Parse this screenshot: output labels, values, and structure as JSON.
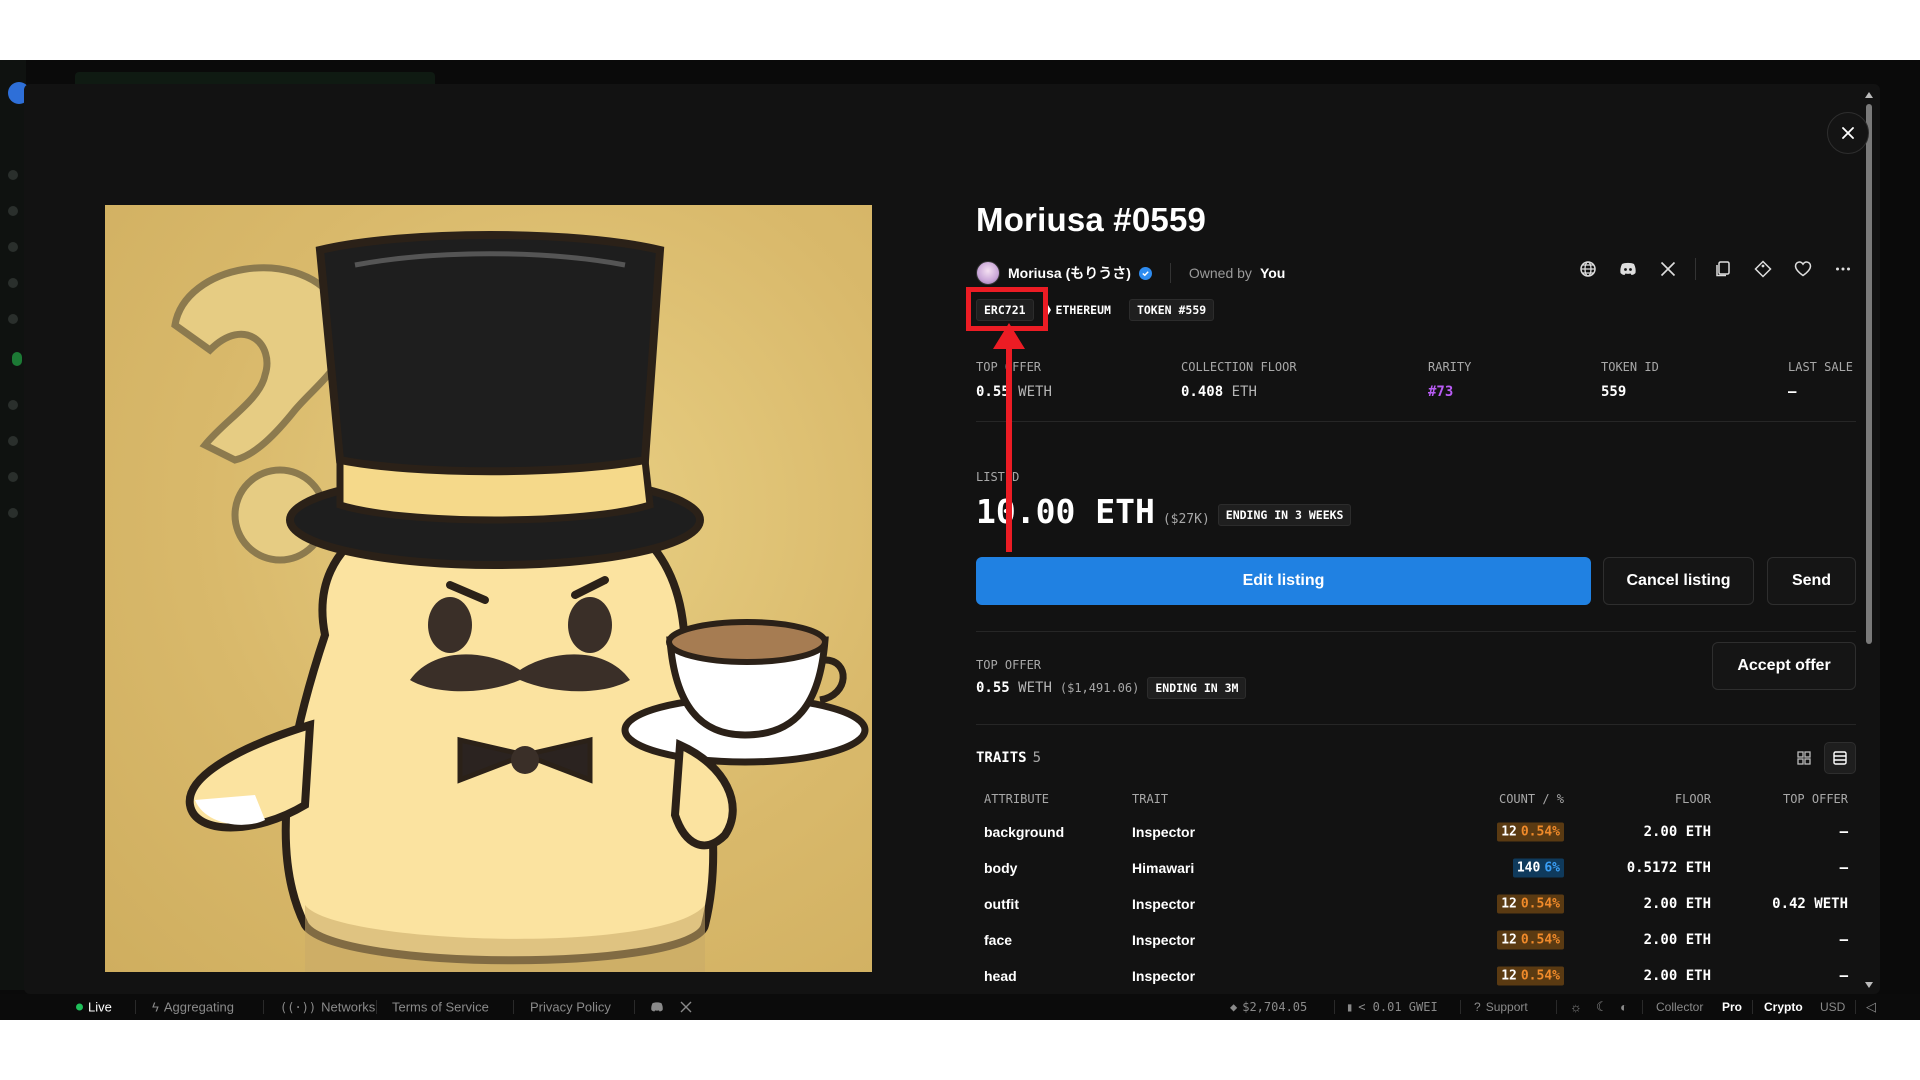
{
  "nft": {
    "title": "Moriusa #0559",
    "collection": "Moriusa (もりうさ)",
    "owned_by_label": "Owned by",
    "owner": "You"
  },
  "tags": {
    "standard": "ERC721",
    "chain": "ETHEREUM",
    "token": "TOKEN #559"
  },
  "stats": [
    {
      "label": "TOP OFFER",
      "value": "0.55",
      "unit": "WETH"
    },
    {
      "label": "COLLECTION FLOOR",
      "value": "0.408",
      "unit": "ETH"
    },
    {
      "label": "RARITY",
      "value": "#73",
      "unit": ""
    },
    {
      "label": "TOKEN ID",
      "value": "559",
      "unit": ""
    },
    {
      "label": "LAST SALE",
      "value": "–",
      "unit": ""
    }
  ],
  "listing": {
    "label": "LISTED",
    "price": "10.00 ETH",
    "usd": "($27K)",
    "ending": "ENDING IN 3 WEEKS"
  },
  "buttons": {
    "edit": "Edit listing",
    "cancel": "Cancel listing",
    "send": "Send",
    "accept": "Accept offer"
  },
  "top_offer": {
    "label": "TOP OFFER",
    "price": "0.55",
    "unit": "WETH",
    "usd": "($1,491.06)",
    "ending": "ENDING IN 3M"
  },
  "traits": {
    "title": "TRAITS",
    "count": "5",
    "columns": [
      "ATTRIBUTE",
      "TRAIT",
      "COUNT / %",
      "FLOOR",
      "TOP OFFER"
    ],
    "rows": [
      {
        "attribute": "background",
        "trait": "Inspector",
        "count": "12",
        "pct": "0.54%",
        "floor": "2.00 ETH",
        "top_offer": "—",
        "tone": "orange"
      },
      {
        "attribute": "body",
        "trait": "Himawari",
        "count": "140",
        "pct": "6%",
        "floor": "0.5172 ETH",
        "top_offer": "—",
        "tone": "blue"
      },
      {
        "attribute": "outfit",
        "trait": "Inspector",
        "count": "12",
        "pct": "0.54%",
        "floor": "2.00 ETH",
        "top_offer": "0.42 WETH",
        "tone": "orange"
      },
      {
        "attribute": "face",
        "trait": "Inspector",
        "count": "12",
        "pct": "0.54%",
        "floor": "2.00 ETH",
        "top_offer": "—",
        "tone": "orange"
      },
      {
        "attribute": "head",
        "trait": "Inspector",
        "count": "12",
        "pct": "0.54%",
        "floor": "2.00 ETH",
        "top_offer": "—",
        "tone": "orange"
      }
    ]
  },
  "statusbar": {
    "live": "Live",
    "aggregating": "Aggregating",
    "networks": "Networks",
    "terms": "Terms of Service",
    "privacy": "Privacy Policy",
    "eth_price": "$2,704.05",
    "gas": "< 0.01 GWEI",
    "support": "Support",
    "collector": "Collector",
    "pro": "Pro",
    "crypto": "Crypto",
    "usd": "USD"
  },
  "colors": {
    "accent": "#2081e2",
    "annotation": "#ec1c24",
    "rarity": "#b95cf5",
    "pill_orange_bg": "#5a3a12",
    "pill_orange_text": "#f08a2a",
    "pill_blue_bg": "#0f3a5c",
    "pill_blue_text": "#3a9ef5"
  }
}
